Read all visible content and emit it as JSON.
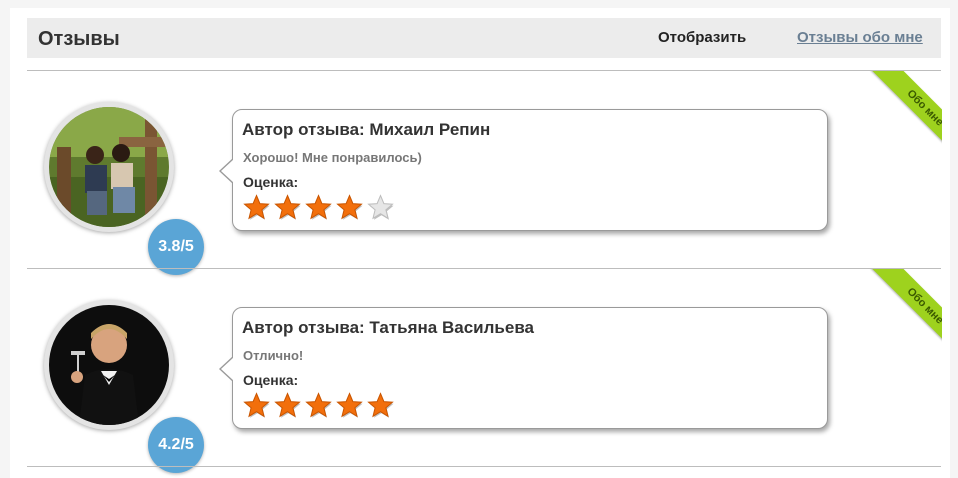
{
  "header": {
    "title": "Отзывы",
    "filter_label": "Отобразить",
    "filter_link": "Отзывы обо мне"
  },
  "reviews": [
    {
      "avatar": "couple-photo",
      "score": "3.8/5",
      "author": "Автор отзыва: Михаил Репин",
      "text": "Хорошо! Мне понравилось)",
      "rating_label": "Оценка:",
      "stars_filled": 4,
      "stars_total": 5,
      "ribbon": "Обо мне"
    },
    {
      "avatar": "man-in-tuxedo-photo",
      "score": "4.2/5",
      "author": "Автор отзыва: Татьяна Васильева",
      "text": "Отлично!",
      "rating_label": "Оценка:",
      "stars_filled": 5,
      "stars_total": 5,
      "ribbon": "Обо мне"
    }
  ],
  "colors": {
    "accent_blue": "#5aa5d6",
    "ribbon_green": "#9ed21e",
    "star_orange": "#f26f0c"
  }
}
